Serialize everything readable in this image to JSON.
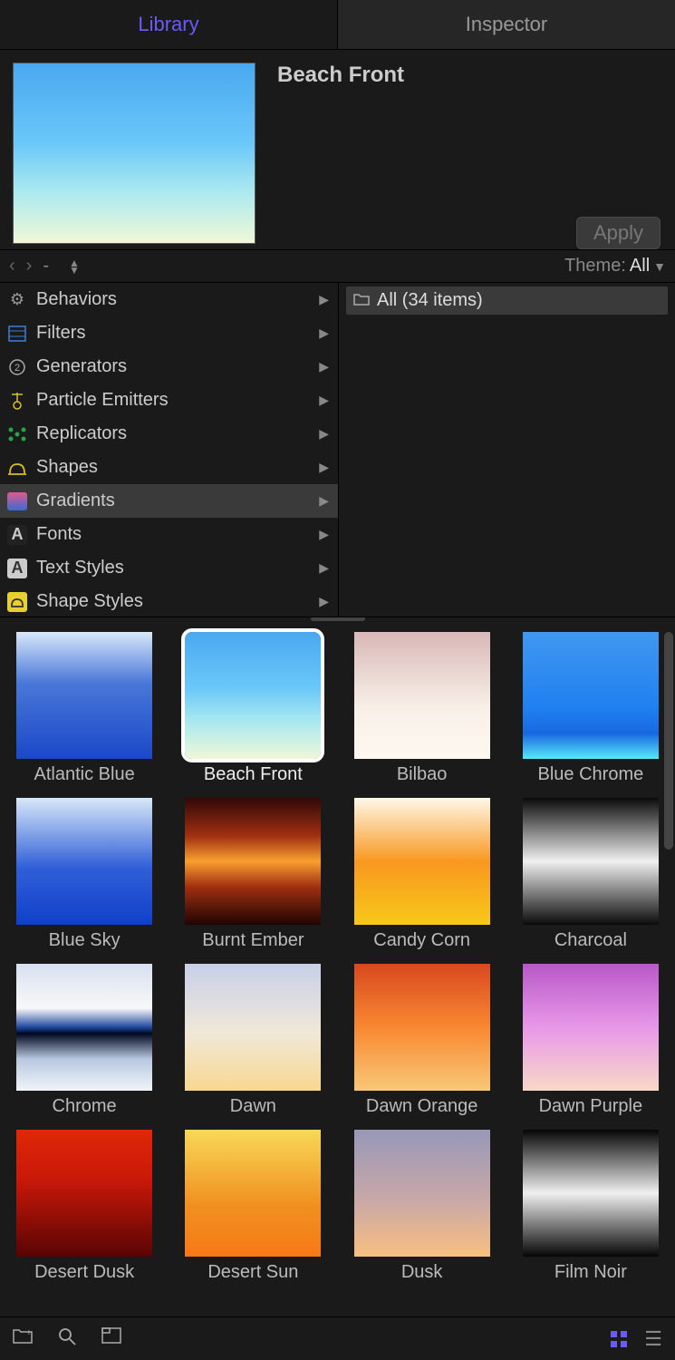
{
  "tabs": {
    "library": "Library",
    "inspector": "Inspector"
  },
  "preview": {
    "title": "Beach Front",
    "apply": "Apply"
  },
  "path": {
    "dash": "-",
    "theme_label": "Theme:",
    "theme_value": "All"
  },
  "categories": [
    {
      "label": "Behaviors",
      "icon": "gear"
    },
    {
      "label": "Filters",
      "icon": "filter"
    },
    {
      "label": "Generators",
      "icon": "gen"
    },
    {
      "label": "Particle Emitters",
      "icon": "particle"
    },
    {
      "label": "Replicators",
      "icon": "repl"
    },
    {
      "label": "Shapes",
      "icon": "shape"
    },
    {
      "label": "Gradients",
      "icon": "grad",
      "selected": true
    },
    {
      "label": "Fonts",
      "icon": "font"
    },
    {
      "label": "Text Styles",
      "icon": "txtstyle"
    },
    {
      "label": "Shape Styles",
      "icon": "shpstyle"
    }
  ],
  "subfolder": {
    "label": "All (34 items)"
  },
  "gradients": [
    {
      "name": "Atlantic Blue",
      "css": "linear-gradient(to bottom,#d8e8fa 0%,#4a78d8 40%,#1a48c8 100%)"
    },
    {
      "name": "Beach Front",
      "css": "linear-gradient(to bottom,#4aa8f0 0%,#6cc8f8 45%,#a8e8f0 70%,#f0f8d8 100%)",
      "selected": true
    },
    {
      "name": "Bilbao",
      "css": "linear-gradient(to bottom,#d8b8b8 0%,#f8f0e8 60%,#fff8f0 100%)"
    },
    {
      "name": "Blue Chrome",
      "css": "linear-gradient(to bottom,#4098f0 0%,#2080f0 60%,#1868e0 80%,#58e8f8 100%)"
    },
    {
      "name": "Blue Sky",
      "css": "linear-gradient(to bottom,#d8e8f8 0%,#3060d8 55%,#1040c8 100%)"
    },
    {
      "name": "Burnt Ember",
      "css": "linear-gradient(to bottom,#300808 0%,#a03010 30%,#f8a030 50%,#a03010 70%,#200404 100%)"
    },
    {
      "name": "Candy Corn",
      "css": "linear-gradient(to bottom,#fff8e8 0%,#f89820 50%,#f8c818 100%)"
    },
    {
      "name": "Charcoal",
      "css": "linear-gradient(to bottom,#0a0a0a 0%,#f0f0f0 50%,#0a0a0a 100%)"
    },
    {
      "name": "Chrome",
      "css": "linear-gradient(to bottom,#d8e0f0 0%,#f8f8f8 35%,#2048a0 50%,#000820 55%,#b8c8e0 75%,#f0f4f8 100%)"
    },
    {
      "name": "Dawn",
      "css": "linear-gradient(to bottom,#c8d0e8 0%,#f0e8d8 55%,#f8d890 100%)"
    },
    {
      "name": "Dawn Orange",
      "css": "linear-gradient(to bottom,#d84820 0%,#f88830 50%,#f8c878 100%)"
    },
    {
      "name": "Dawn Purple",
      "css": "linear-gradient(to bottom,#b858c8 0%,#e898e8 50%,#f8d8c8 100%)"
    },
    {
      "name": "Desert Dusk",
      "css": "linear-gradient(to bottom,#e02808 0%,#c81808 40%,#580404 100%)"
    },
    {
      "name": "Desert Sun",
      "css": "linear-gradient(to bottom,#f8d858 0%,#f09020 60%,#f87818 100%)"
    },
    {
      "name": "Dusk",
      "css": "linear-gradient(to bottom,#9898b8 0%,#c8a8a8 55%,#f8c080 100%)"
    },
    {
      "name": "Film Noir",
      "css": "linear-gradient(to bottom,#050505 0%,#f0f0f0 50%,#050505 100%)"
    }
  ]
}
